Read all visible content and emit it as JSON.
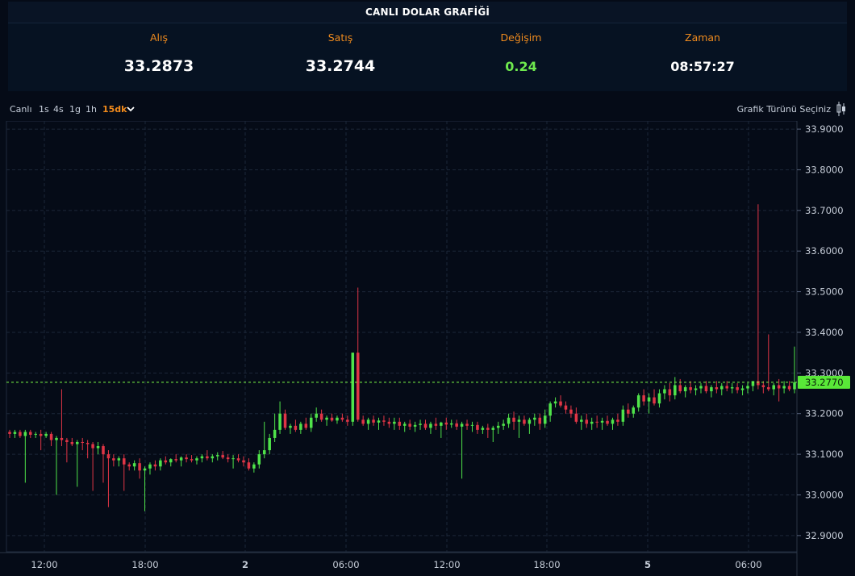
{
  "header": {
    "title": "CANLI DOLAR GRAFİĞİ"
  },
  "stats": {
    "buy_label": "Alış",
    "buy_value": "33.2873",
    "sell_label": "Satış",
    "sell_value": "33.2744",
    "change_label": "Değişim",
    "change_value": "0.24",
    "time_label": "Zaman",
    "time_value": "08:57:27"
  },
  "toolbar": {
    "timeframes": [
      "Canlı",
      "1s",
      "4s",
      "1g",
      "1h",
      "15dk"
    ],
    "active": "15dk",
    "chart_type_label": "Grafik Türünü Seçiniz",
    "chart_type_icon": "candlestick-icon",
    "dropdown_icon": "chevron-down-icon"
  },
  "colors": {
    "up": "#4fe34a",
    "down": "#e03546",
    "accent": "#f08a1c",
    "current_price": "#7cff47"
  },
  "chart_data": {
    "type": "candlestick",
    "current_price": 33.277,
    "current_price_label": "33.2770",
    "ylim": [
      32.86,
      33.92
    ],
    "y_ticks": [
      "33.9000",
      "33.8000",
      "33.7000",
      "33.6000",
      "33.5000",
      "33.4000",
      "33.3000",
      "33.2000",
      "33.1000",
      "33.0000",
      "32.9000"
    ],
    "x_tick_labels": [
      {
        "label": "12:00",
        "bold": false
      },
      {
        "label": "18:00",
        "bold": false
      },
      {
        "label": "2",
        "bold": true
      },
      {
        "label": "06:00",
        "bold": false
      },
      {
        "label": "12:00",
        "bold": false
      },
      {
        "label": "18:00",
        "bold": false
      },
      {
        "label": "5",
        "bold": true
      },
      {
        "label": "06:00",
        "bold": false
      }
    ],
    "grid": true,
    "candles": [
      [
        33.155,
        33.16,
        33.14,
        33.15
      ],
      [
        33.15,
        33.16,
        33.14,
        33.155
      ],
      [
        33.155,
        33.16,
        33.14,
        33.145
      ],
      [
        33.145,
        33.16,
        33.03,
        33.155
      ],
      [
        33.155,
        33.16,
        33.14,
        33.148
      ],
      [
        33.148,
        33.155,
        33.14,
        33.15
      ],
      [
        33.15,
        33.16,
        33.11,
        33.145
      ],
      [
        33.145,
        33.155,
        33.14,
        33.15
      ],
      [
        33.15,
        33.155,
        33.12,
        33.135
      ],
      [
        33.135,
        33.145,
        33.0,
        33.14
      ],
      [
        33.14,
        33.26,
        33.12,
        33.135
      ],
      [
        33.135,
        33.14,
        33.08,
        33.13
      ],
      [
        33.13,
        33.14,
        33.12,
        33.125
      ],
      [
        33.125,
        33.135,
        33.02,
        33.13
      ],
      [
        33.13,
        33.14,
        33.11,
        33.128
      ],
      [
        33.128,
        33.135,
        33.09,
        33.125
      ],
      [
        33.125,
        33.13,
        33.01,
        33.115
      ],
      [
        33.115,
        33.13,
        33.1,
        33.12
      ],
      [
        33.12,
        33.125,
        33.03,
        33.1
      ],
      [
        33.1,
        33.11,
        32.97,
        33.09
      ],
      [
        33.09,
        33.1,
        33.07,
        33.085
      ],
      [
        33.085,
        33.095,
        33.07,
        33.09
      ],
      [
        33.09,
        33.1,
        33.01,
        33.075
      ],
      [
        33.075,
        33.08,
        33.06,
        33.07
      ],
      [
        33.07,
        33.085,
        33.06,
        33.078
      ],
      [
        33.078,
        33.09,
        33.04,
        33.06
      ],
      [
        33.06,
        33.07,
        32.96,
        33.065
      ],
      [
        33.065,
        33.08,
        33.05,
        33.075
      ],
      [
        33.075,
        33.085,
        33.06,
        33.07
      ],
      [
        33.07,
        33.09,
        33.06,
        33.085
      ],
      [
        33.085,
        33.095,
        33.075,
        33.08
      ],
      [
        33.08,
        33.09,
        33.07,
        33.088
      ],
      [
        33.088,
        33.1,
        33.08,
        33.085
      ],
      [
        33.085,
        33.095,
        33.07,
        33.092
      ],
      [
        33.092,
        33.1,
        33.08,
        33.088
      ],
      [
        33.088,
        33.098,
        33.08,
        33.085
      ],
      [
        33.085,
        33.095,
        33.075,
        33.09
      ],
      [
        33.09,
        33.1,
        33.08,
        33.095
      ],
      [
        33.095,
        33.11,
        33.085,
        33.09
      ],
      [
        33.09,
        33.1,
        33.08,
        33.095
      ],
      [
        33.095,
        33.105,
        33.085,
        33.098
      ],
      [
        33.098,
        33.108,
        33.088,
        33.092
      ],
      [
        33.092,
        33.1,
        33.08,
        33.088
      ],
      [
        33.088,
        33.098,
        33.065,
        33.09
      ],
      [
        33.09,
        33.1,
        33.08,
        33.085
      ],
      [
        33.085,
        33.095,
        33.07,
        33.08
      ],
      [
        33.08,
        33.09,
        33.06,
        33.065
      ],
      [
        33.065,
        33.08,
        33.055,
        33.075
      ],
      [
        33.075,
        33.11,
        33.065,
        33.1
      ],
      [
        33.1,
        33.18,
        33.09,
        33.11
      ],
      [
        33.11,
        33.15,
        33.1,
        33.14
      ],
      [
        33.14,
        33.2,
        33.13,
        33.16
      ],
      [
        33.16,
        33.23,
        33.15,
        33.2
      ],
      [
        33.2,
        33.21,
        33.16,
        33.165
      ],
      [
        33.165,
        33.175,
        33.15,
        33.17
      ],
      [
        33.17,
        33.185,
        33.155,
        33.16
      ],
      [
        33.16,
        33.18,
        33.15,
        33.175
      ],
      [
        33.175,
        33.19,
        33.16,
        33.165
      ],
      [
        33.165,
        33.2,
        33.155,
        33.19
      ],
      [
        33.19,
        33.215,
        33.18,
        33.2
      ],
      [
        33.2,
        33.21,
        33.18,
        33.185
      ],
      [
        33.185,
        33.195,
        33.17,
        33.19
      ],
      [
        33.19,
        33.2,
        33.18,
        33.183
      ],
      [
        33.183,
        33.195,
        33.175,
        33.19
      ],
      [
        33.19,
        33.2,
        33.18,
        33.185
      ],
      [
        33.185,
        33.195,
        33.17,
        33.18
      ],
      [
        33.18,
        33.35,
        33.17,
        33.35
      ],
      [
        33.35,
        33.51,
        33.18,
        33.185
      ],
      [
        33.185,
        33.195,
        33.17,
        33.175
      ],
      [
        33.175,
        33.19,
        33.16,
        33.185
      ],
      [
        33.185,
        33.195,
        33.17,
        33.178
      ],
      [
        33.178,
        33.19,
        33.16,
        33.183
      ],
      [
        33.183,
        33.195,
        33.17,
        33.18
      ],
      [
        33.18,
        33.19,
        33.165,
        33.175
      ],
      [
        33.175,
        33.19,
        33.16,
        33.18
      ],
      [
        33.18,
        33.19,
        33.16,
        33.17
      ],
      [
        33.17,
        33.18,
        33.155,
        33.175
      ],
      [
        33.175,
        33.185,
        33.16,
        33.168
      ],
      [
        33.168,
        33.18,
        33.155,
        33.172
      ],
      [
        33.172,
        33.185,
        33.16,
        33.175
      ],
      [
        33.175,
        33.185,
        33.16,
        33.165
      ],
      [
        33.165,
        33.18,
        33.15,
        33.175
      ],
      [
        33.175,
        33.19,
        33.16,
        33.17
      ],
      [
        33.17,
        33.18,
        33.14,
        33.178
      ],
      [
        33.178,
        33.19,
        33.16,
        33.173
      ],
      [
        33.173,
        33.185,
        33.165,
        33.176
      ],
      [
        33.176,
        33.185,
        33.16,
        33.168
      ],
      [
        33.168,
        33.18,
        33.04,
        33.175
      ],
      [
        33.175,
        33.185,
        33.16,
        33.17
      ],
      [
        33.17,
        33.18,
        33.155,
        33.172
      ],
      [
        33.172,
        33.18,
        33.15,
        33.16
      ],
      [
        33.16,
        33.17,
        33.15,
        33.165
      ],
      [
        33.165,
        33.175,
        33.14,
        33.16
      ],
      [
        33.16,
        33.17,
        33.13,
        33.165
      ],
      [
        33.165,
        33.18,
        33.15,
        33.17
      ],
      [
        33.17,
        33.185,
        33.16,
        33.175
      ],
      [
        33.175,
        33.2,
        33.165,
        33.19
      ],
      [
        33.19,
        33.205,
        33.16,
        33.18
      ],
      [
        33.18,
        33.195,
        33.14,
        33.185
      ],
      [
        33.185,
        33.195,
        33.17,
        33.175
      ],
      [
        33.175,
        33.19,
        33.15,
        33.185
      ],
      [
        33.185,
        33.2,
        33.17,
        33.19
      ],
      [
        33.19,
        33.2,
        33.16,
        33.175
      ],
      [
        33.175,
        33.21,
        33.165,
        33.195
      ],
      [
        33.195,
        33.23,
        33.18,
        33.225
      ],
      [
        33.225,
        33.24,
        33.215,
        33.23
      ],
      [
        33.23,
        33.245,
        33.215,
        33.22
      ],
      [
        33.22,
        33.23,
        33.2,
        33.21
      ],
      [
        33.21,
        33.22,
        33.19,
        33.2
      ],
      [
        33.2,
        33.215,
        33.175,
        33.18
      ],
      [
        33.18,
        33.195,
        33.16,
        33.185
      ],
      [
        33.185,
        33.2,
        33.165,
        33.175
      ],
      [
        33.175,
        33.19,
        33.16,
        33.18
      ],
      [
        33.18,
        33.195,
        33.165,
        33.178
      ],
      [
        33.178,
        33.19,
        33.16,
        33.182
      ],
      [
        33.182,
        33.195,
        33.17,
        33.175
      ],
      [
        33.175,
        33.19,
        33.16,
        33.185
      ],
      [
        33.185,
        33.2,
        33.17,
        33.18
      ],
      [
        33.18,
        33.22,
        33.17,
        33.21
      ],
      [
        33.21,
        33.225,
        33.19,
        33.2
      ],
      [
        33.2,
        33.22,
        33.19,
        33.215
      ],
      [
        33.215,
        33.25,
        33.205,
        33.245
      ],
      [
        33.245,
        33.26,
        33.22,
        33.23
      ],
      [
        33.23,
        33.25,
        33.2,
        33.24
      ],
      [
        33.24,
        33.26,
        33.22,
        33.225
      ],
      [
        33.225,
        33.26,
        33.215,
        33.25
      ],
      [
        33.25,
        33.27,
        33.235,
        33.26
      ],
      [
        33.26,
        33.275,
        33.23,
        33.245
      ],
      [
        33.245,
        33.29,
        33.235,
        33.27
      ],
      [
        33.27,
        33.285,
        33.25,
        33.255
      ],
      [
        33.255,
        33.27,
        33.24,
        33.265
      ],
      [
        33.265,
        33.28,
        33.25,
        33.258
      ],
      [
        33.258,
        33.27,
        33.245,
        33.262
      ],
      [
        33.262,
        33.275,
        33.25,
        33.268
      ],
      [
        33.268,
        33.28,
        33.25,
        33.255
      ],
      [
        33.255,
        33.27,
        33.24,
        33.265
      ],
      [
        33.265,
        33.28,
        33.25,
        33.26
      ],
      [
        33.26,
        33.275,
        33.245,
        33.268
      ],
      [
        33.268,
        33.28,
        33.255,
        33.262
      ],
      [
        33.262,
        33.275,
        33.25,
        33.265
      ],
      [
        33.265,
        33.275,
        33.25,
        33.258
      ],
      [
        33.258,
        33.27,
        33.245,
        33.262
      ],
      [
        33.262,
        33.275,
        33.25,
        33.268
      ],
      [
        33.268,
        33.28,
        33.255,
        33.28
      ],
      [
        33.28,
        33.715,
        33.26,
        33.27
      ],
      [
        33.27,
        33.28,
        33.25,
        33.265
      ],
      [
        33.265,
        33.395,
        33.255,
        33.26
      ],
      [
        33.26,
        33.275,
        33.245,
        33.27
      ],
      [
        33.27,
        33.285,
        33.23,
        33.262
      ],
      [
        33.262,
        33.28,
        33.25,
        33.268
      ],
      [
        33.268,
        33.28,
        33.255,
        33.26
      ],
      [
        33.26,
        33.365,
        33.25,
        33.277
      ]
    ]
  }
}
